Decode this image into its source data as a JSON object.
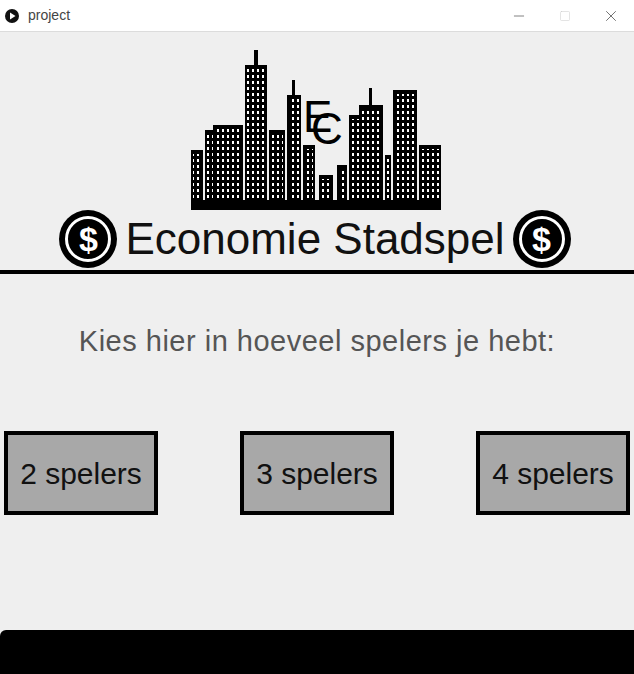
{
  "window": {
    "title": "project"
  },
  "logo": {
    "letters": [
      "E",
      "C"
    ]
  },
  "title": "Economie Stadspel",
  "coin_symbol": "$",
  "prompt": "Kies hier in hoeveel spelers je hebt:",
  "buttons": [
    {
      "label": "2 spelers"
    },
    {
      "label": "3 spelers"
    },
    {
      "label": "4 spelers"
    }
  ]
}
